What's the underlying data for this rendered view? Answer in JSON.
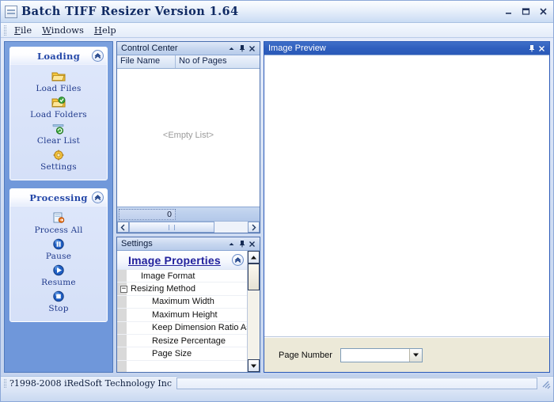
{
  "window": {
    "title": "Batch TIFF Resizer Version 1.64",
    "icon": "app-document-icon",
    "minimize_label": "–",
    "maximize_label": "❐",
    "close_label": "✕"
  },
  "menubar": {
    "items": [
      {
        "id": "file",
        "accel": "F",
        "rest": "ile"
      },
      {
        "id": "windows",
        "accel": "W",
        "rest": "indows"
      },
      {
        "id": "help",
        "accel": "H",
        "rest": "elp"
      }
    ]
  },
  "navbar": {
    "groups": [
      {
        "title": "Loading",
        "collapse_glyph": "«",
        "items": [
          {
            "label": "Load Files",
            "icon": "folder-open-icon"
          },
          {
            "label": "Load Folders",
            "icon": "folders-icon"
          },
          {
            "label": "Clear List",
            "icon": "clear-list-icon"
          },
          {
            "label": "Settings",
            "icon": "settings-gear-icon"
          }
        ]
      },
      {
        "title": "Processing",
        "collapse_glyph": "«",
        "items": [
          {
            "label": "Process All",
            "icon": "process-all-icon"
          },
          {
            "label": "Pause",
            "icon": "pause-icon"
          },
          {
            "label": "Resume",
            "icon": "play-icon"
          },
          {
            "label": "Stop",
            "icon": "stop-icon"
          }
        ]
      }
    ]
  },
  "control_center": {
    "title": "Control Center",
    "auto_hide_glyph": "▲",
    "pin_glyph": "⚓",
    "close_glyph": "✕",
    "columns": [
      "File Name",
      "No of Pages"
    ],
    "rows": [],
    "empty_text": "<Empty List>",
    "count": "0",
    "scroll_left_glyph": "‹",
    "scroll_right_glyph": "›"
  },
  "settings": {
    "title": "Settings",
    "auto_hide_glyph": "▲",
    "pin_glyph": "⚓",
    "close_glyph": "✕",
    "section_title": "Image Properties",
    "section_collapse_glyph": "«",
    "tree": [
      {
        "label": "Image Format",
        "level": 1,
        "expander": ""
      },
      {
        "label": "Resizing Method",
        "level": 0,
        "expander": "−"
      },
      {
        "label": "Maximum Width",
        "level": 2,
        "expander": ""
      },
      {
        "label": "Maximum Height",
        "level": 2,
        "expander": ""
      },
      {
        "label": "Keep Dimension Ratio Asp",
        "level": 2,
        "expander": ""
      },
      {
        "label": "Resize Percentage",
        "level": 2,
        "expander": ""
      },
      {
        "label": "Page Size",
        "level": 2,
        "expander": ""
      }
    ],
    "scroll_up_glyph": "▲",
    "scroll_down_glyph": "▼"
  },
  "image_preview": {
    "title": "Image Preview",
    "pin_glyph": "⚓",
    "close_glyph": "✕",
    "page_number_label": "Page Number",
    "page_number_value": "",
    "page_number_arrow": "▼"
  },
  "statusbar": {
    "copyright": "?1998-2008 iRedSoft Technology Inc",
    "message": ""
  },
  "colors": {
    "accent_blue": "#2a59b8",
    "nav_blue": "#6f97da",
    "title_text": "#102a63",
    "header_link": "#22219c",
    "window_bg": "#cfdcf2"
  }
}
